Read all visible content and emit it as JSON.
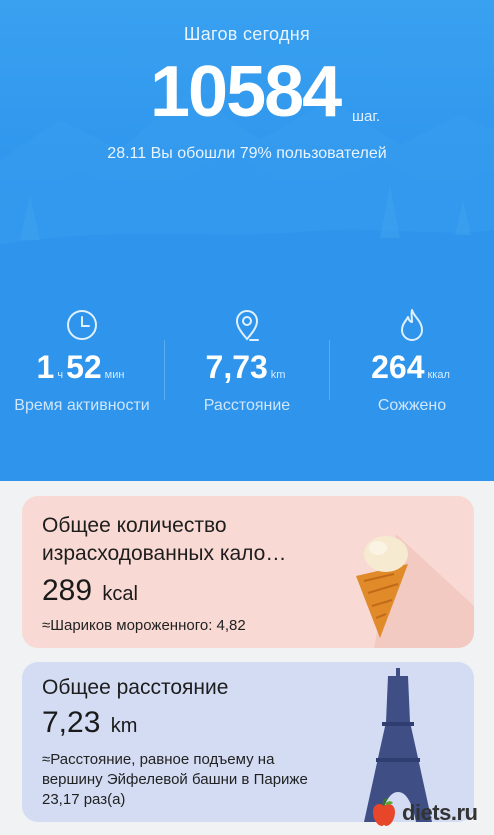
{
  "header": {
    "title": "Шагов сегодня",
    "steps": "10584",
    "unit": "шаг.",
    "subtitle": "28.11 Вы обошли 79% пользователей"
  },
  "stats": {
    "time": {
      "hours": "1",
      "hours_unit": "ч",
      "minutes": "52",
      "minutes_unit": "мин",
      "label": "Время активности",
      "icon": "clock-icon"
    },
    "distance": {
      "value": "7,73",
      "unit": "km",
      "label": "Расстояние",
      "icon": "location-pin-icon"
    },
    "calories": {
      "value": "264",
      "unit": "ккал",
      "label": "Сожжено",
      "icon": "flame-icon"
    }
  },
  "cards": {
    "calories": {
      "title": "Общее количество израсходованных кало…",
      "value": "289",
      "unit": "kcal",
      "note": "≈Шариков мороженного: 4,82",
      "icon": "ice-cream-icon"
    },
    "distance": {
      "title": "Общее расстояние",
      "value": "7,23",
      "unit": "km",
      "note": "≈Расстояние, равное подъему на вершину Эйфелевой башни в Париже 23,17 раз(а)",
      "icon": "eiffel-tower-icon"
    }
  },
  "watermark": {
    "text": "diets.ru"
  },
  "colors": {
    "hero": "#2b93ec",
    "card_calories": "#f8d9d3",
    "card_distance": "#d3dcf3"
  }
}
